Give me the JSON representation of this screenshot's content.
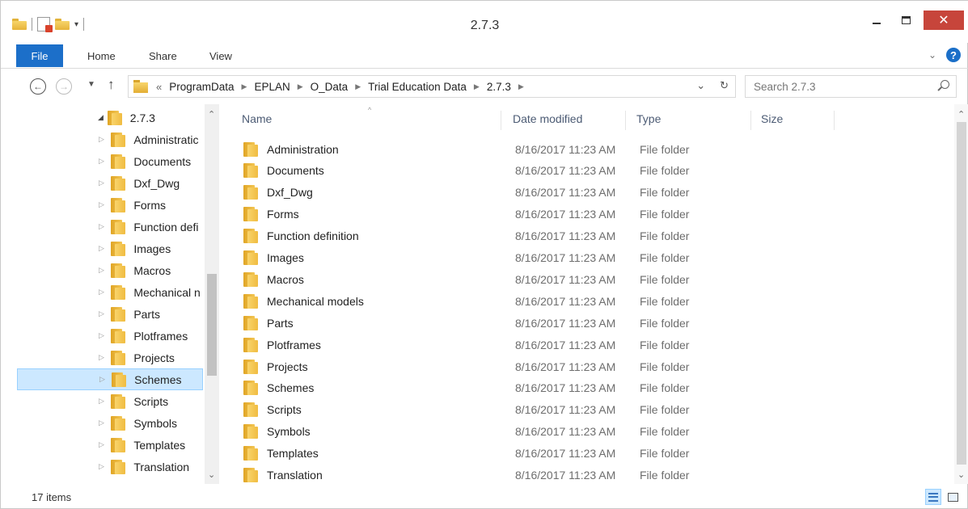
{
  "window": {
    "title": "2.7.3"
  },
  "ribbon": {
    "tabs": [
      "File",
      "Home",
      "Share",
      "View"
    ]
  },
  "address": {
    "overflow": "«",
    "breadcrumbs": [
      "ProgramData",
      "EPLAN",
      "O_Data",
      "Trial Education Data",
      "2.7.3"
    ]
  },
  "search": {
    "placeholder": "Search 2.7.3"
  },
  "nav_pane": {
    "root": "2.7.3",
    "items": [
      {
        "label": "Administratic"
      },
      {
        "label": "Documents"
      },
      {
        "label": "Dxf_Dwg"
      },
      {
        "label": "Forms"
      },
      {
        "label": "Function defi"
      },
      {
        "label": "Images"
      },
      {
        "label": "Macros"
      },
      {
        "label": "Mechanical n"
      },
      {
        "label": "Parts"
      },
      {
        "label": "Plotframes"
      },
      {
        "label": "Projects"
      },
      {
        "label": "Schemes"
      },
      {
        "label": "Scripts"
      },
      {
        "label": "Symbols"
      },
      {
        "label": "Templates"
      },
      {
        "label": "Translation"
      }
    ],
    "selected": "Schemes"
  },
  "columns": {
    "name": "Name",
    "date": "Date modified",
    "type": "Type",
    "size": "Size"
  },
  "files": [
    {
      "name": "Administration",
      "date": "8/16/2017 11:23 AM",
      "type": "File folder"
    },
    {
      "name": "Documents",
      "date": "8/16/2017 11:23 AM",
      "type": "File folder"
    },
    {
      "name": "Dxf_Dwg",
      "date": "8/16/2017 11:23 AM",
      "type": "File folder"
    },
    {
      "name": "Forms",
      "date": "8/16/2017 11:23 AM",
      "type": "File folder"
    },
    {
      "name": "Function definition",
      "date": "8/16/2017 11:23 AM",
      "type": "File folder"
    },
    {
      "name": "Images",
      "date": "8/16/2017 11:23 AM",
      "type": "File folder"
    },
    {
      "name": "Macros",
      "date": "8/16/2017 11:23 AM",
      "type": "File folder"
    },
    {
      "name": "Mechanical models",
      "date": "8/16/2017 11:23 AM",
      "type": "File folder"
    },
    {
      "name": "Parts",
      "date": "8/16/2017 11:23 AM",
      "type": "File folder"
    },
    {
      "name": "Plotframes",
      "date": "8/16/2017 11:23 AM",
      "type": "File folder"
    },
    {
      "name": "Projects",
      "date": "8/16/2017 11:23 AM",
      "type": "File folder"
    },
    {
      "name": "Schemes",
      "date": "8/16/2017 11:23 AM",
      "type": "File folder"
    },
    {
      "name": "Scripts",
      "date": "8/16/2017 11:23 AM",
      "type": "File folder"
    },
    {
      "name": "Symbols",
      "date": "8/16/2017 11:23 AM",
      "type": "File folder"
    },
    {
      "name": "Templates",
      "date": "8/16/2017 11:23 AM",
      "type": "File folder"
    },
    {
      "name": "Translation",
      "date": "8/16/2017 11:23 AM",
      "type": "File folder"
    }
  ],
  "status": {
    "count": "17 items"
  },
  "colors": {
    "accent": "#1c6fc9",
    "close": "#c7453b",
    "selection": "#cce8ff"
  }
}
